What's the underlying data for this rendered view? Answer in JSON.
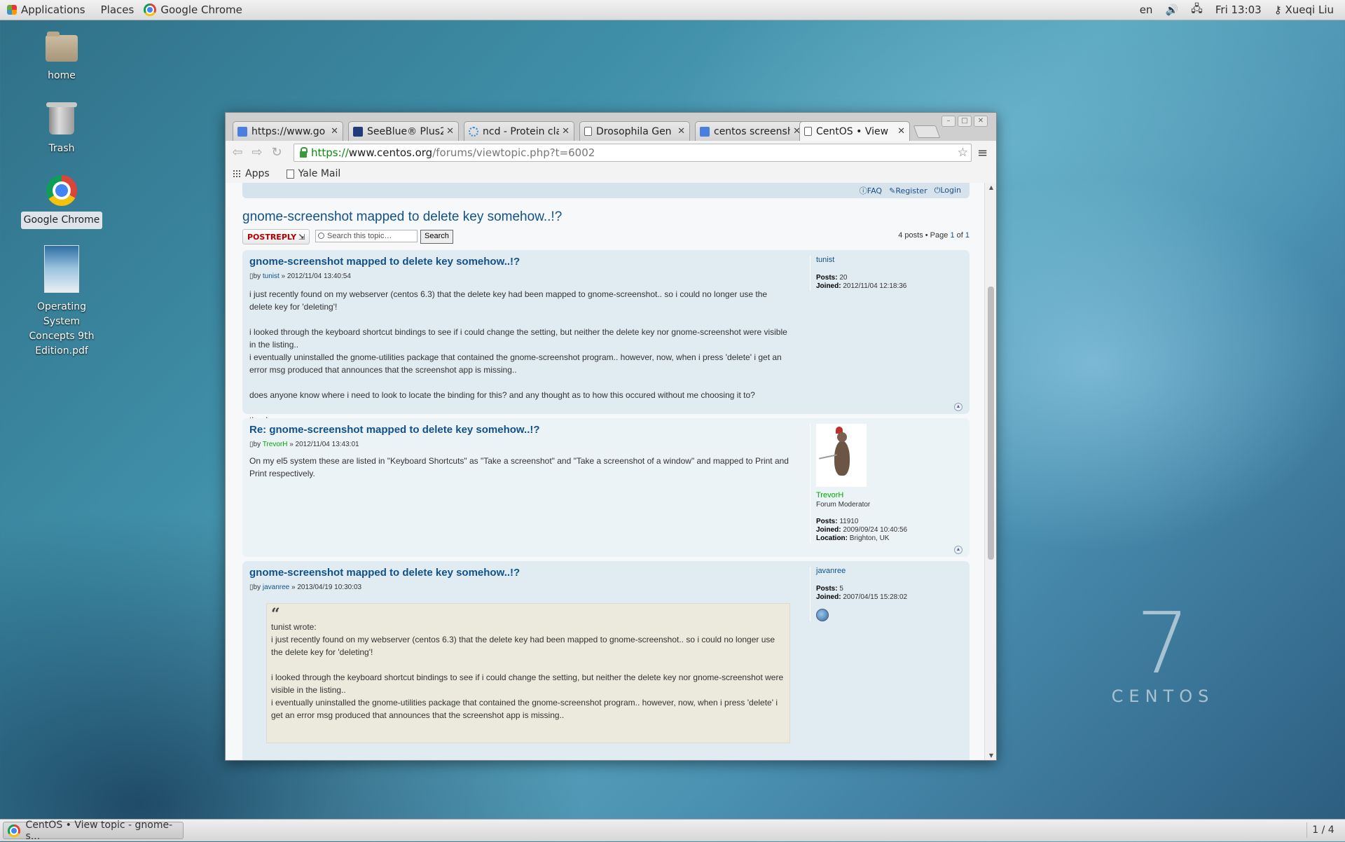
{
  "topbar": {
    "applications": "Applications",
    "places": "Places",
    "active_app": "Google Chrome",
    "lang": "en",
    "clock": "Fri 13:03",
    "user": "Xueqi Liu"
  },
  "desktop": {
    "icons": [
      {
        "label": "home",
        "icon": "folder-home-icon"
      },
      {
        "label": "Trash",
        "icon": "trash-icon"
      },
      {
        "label": "Google Chrome",
        "icon": "chrome-icon"
      },
      {
        "label": "Operating System Concepts 9th Edition.pdf",
        "icon": "pdf-file-icon"
      }
    ],
    "brand_number": "7",
    "brand_word": "CENTOS"
  },
  "browser": {
    "tabs": [
      {
        "title": "https://www.go",
        "favicon": "google-icon",
        "fav_color": "#4a7fe0"
      },
      {
        "title": "SeeBlue® Plus2",
        "favicon": "lifetech-icon",
        "fav_color": "#223b7a"
      },
      {
        "title": "ncd - Protein cla",
        "favicon": "loading-spinner-icon",
        "fav_color": "#3a8ad0"
      },
      {
        "title": "Drosophila Gen",
        "favicon": "document-icon",
        "fav_color": "#ffffff"
      },
      {
        "title": "centos screensh",
        "favicon": "google-icon",
        "fav_color": "#4a7fe0"
      },
      {
        "title": "CentOS • View",
        "favicon": "document-icon",
        "fav_color": "#ffffff"
      }
    ],
    "url_scheme": "https://",
    "url_host": "www.centos.org",
    "url_path": "/forums/viewtopic.php?t=6002",
    "bookmarks": [
      {
        "label": "Apps"
      },
      {
        "label": "Yale Mail"
      }
    ]
  },
  "forum": {
    "header_links": {
      "faq": "FAQ",
      "register": "Register",
      "login": "Login"
    },
    "topic_title": "gnome-screenshot mapped to delete key somehow..!?",
    "post_reply": "POSTREPLY",
    "search_placeholder": "Search this topic…",
    "search_button": "Search",
    "pagination": {
      "prefix": "4 posts • Page",
      "current": "1",
      "of": "of",
      "total": "1"
    },
    "posts": [
      {
        "title": "gnome-screenshot mapped to delete key somehow..!?",
        "by": "by",
        "author": "tunist",
        "date": "» 2012/11/04 13:40:54",
        "body": [
          "i just recently found on my webserver (centos 6.3) that the delete key had been mapped to gnome-screenshot.. so i could no longer use the delete key for 'deleting'!",
          "i looked through the keyboard shortcut bindings to see if i could change the setting, but neither the delete key nor gnome-screenshot were visible in the listing..",
          "i eventually uninstalled the gnome-utilities package that contained the gnome-screenshot program.. however, now, when i press 'delete' i get an error msg produced that announces that the screenshot app is missing..",
          "does anyone know where i need to look to locate the binding for this? and any thought as to how this occured without me choosing it to?",
          "thanks"
        ],
        "profile": {
          "name": "tunist",
          "posts_label": "Posts:",
          "posts": "20",
          "joined_label": "Joined:",
          "joined": "2012/11/04 12:18:36"
        }
      },
      {
        "title": "Re: gnome-screenshot mapped to delete key somehow..!?",
        "by": "by",
        "author": "TrevorH",
        "date": "» 2012/11/04 13:43:01",
        "body": [
          "On my el5 system these are listed in \"Keyboard Shortcuts\" as \"Take a screenshot\" and \"Take a screenshot of a window\" and mapped to Print and Print respectively."
        ],
        "profile": {
          "name": "TrevorH",
          "rank": "Forum Moderator",
          "posts_label": "Posts:",
          "posts": "11910",
          "joined_label": "Joined:",
          "joined": "2009/09/24 10:40:56",
          "location_label": "Location:",
          "location": "Brighton, UK"
        }
      },
      {
        "title": "gnome-screenshot mapped to delete key somehow..!?",
        "by": "by",
        "author": "javanree",
        "date": "» 2013/04/19 10:30:03",
        "quote": {
          "mark": "“",
          "cite": "tunist wrote:",
          "lines": [
            "i just recently found on my webserver (centos 6.3) that the delete key had been mapped to gnome-screenshot.. so i could no longer use the delete key for 'deleting'!",
            "i looked through the keyboard shortcut bindings to see if i could change the setting, but neither the delete key nor gnome-screenshot were visible in the listing..\ni eventually uninstalled the gnome-utilities package that contained the gnome-screenshot program.. however, now, when i press 'delete' i get an error msg produced that announces that the screenshot app is missing.."
          ]
        },
        "profile": {
          "name": "javanree",
          "posts_label": "Posts:",
          "posts": "5",
          "joined_label": "Joined:",
          "joined": "2007/04/15 15:28:02"
        }
      }
    ]
  },
  "taskbar": {
    "task_title": "CentOS • View topic - gnome-s...",
    "workspace": "1 / 4"
  }
}
